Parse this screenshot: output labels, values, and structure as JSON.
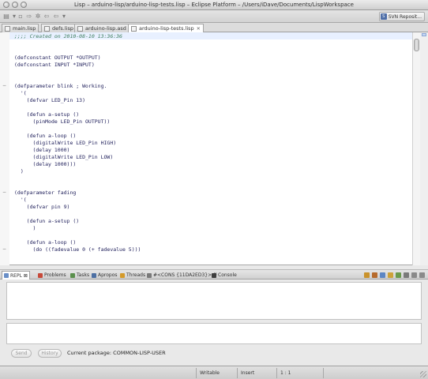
{
  "window": {
    "title": "Lisp – arduino-lisp/arduino-lisp-tests.lisp – Eclipse Platform – /Users/iDave/Documents/LispWorkspace"
  },
  "toolbar": {
    "svn_label": "SVN Reposit...",
    "icons": [
      "new-file-icon",
      "dropdown-icon",
      "save-icon",
      "forward-icon",
      "settings-icon",
      "open-icon",
      "back-icon"
    ]
  },
  "editor_tabs": [
    {
      "label": "main.lisp",
      "active": false
    },
    {
      "label": "defs.lisp",
      "active": false
    },
    {
      "label": "arduino-lisp.asd",
      "active": false
    },
    {
      "label": "arduino-lisp-tests.lisp",
      "active": true
    }
  ],
  "editor": {
    "lines": [
      {
        "text": ";;;; Created on 2010-08-10 13:36:36",
        "kind": "comment"
      },
      {
        "text": "",
        "kind": "code"
      },
      {
        "text": "",
        "kind": "code"
      },
      {
        "text": "(defconstant OUTPUT *OUTPUT)",
        "kind": "code"
      },
      {
        "text": "(defconstant INPUT *INPUT)",
        "kind": "code"
      },
      {
        "text": "",
        "kind": "code"
      },
      {
        "text": "",
        "kind": "code"
      },
      {
        "text": "(defparameter blink ; Working.",
        "kind": "code"
      },
      {
        "text": "  '(",
        "kind": "code"
      },
      {
        "text": "    (defvar LED_Pin 13)",
        "kind": "code"
      },
      {
        "text": "",
        "kind": "code"
      },
      {
        "text": "    (defun a-setup ()",
        "kind": "code"
      },
      {
        "text": "      (pinMode LED_Pin OUTPUT))",
        "kind": "code"
      },
      {
        "text": "",
        "kind": "code"
      },
      {
        "text": "    (defun a-loop ()",
        "kind": "code"
      },
      {
        "text": "      (digitalWrite LED_Pin HIGH)",
        "kind": "code"
      },
      {
        "text": "      (delay 1000)",
        "kind": "code"
      },
      {
        "text": "      (digitalWrite LED_Pin LOW)",
        "kind": "code"
      },
      {
        "text": "      (delay 1000)))",
        "kind": "code"
      },
      {
        "text": "  )",
        "kind": "code"
      },
      {
        "text": "",
        "kind": "code"
      },
      {
        "text": "",
        "kind": "code"
      },
      {
        "text": "(defparameter fading",
        "kind": "code"
      },
      {
        "text": "  '(",
        "kind": "code"
      },
      {
        "text": "    (defvar pin 9)",
        "kind": "code"
      },
      {
        "text": "",
        "kind": "code"
      },
      {
        "text": "    (defun a-setup ()",
        "kind": "code"
      },
      {
        "text": "      )",
        "kind": "code"
      },
      {
        "text": "",
        "kind": "code"
      },
      {
        "text": "    (defun a-loop ()",
        "kind": "code"
      },
      {
        "text": "      (do ((fadevalue 0 (+ fadevalue 5)))",
        "kind": "code"
      }
    ],
    "fold_markers": [
      "−",
      "−",
      "−"
    ]
  },
  "view_tabs": [
    {
      "label": "REPL",
      "active": true,
      "close": "⊠",
      "color": "#6a8fc7"
    },
    {
      "label": "Problems",
      "active": false,
      "close": "",
      "color": "#c74a3a"
    },
    {
      "label": "Tasks",
      "active": false,
      "close": "",
      "color": "#5a8f4c"
    },
    {
      "label": "Apropos",
      "active": false,
      "close": "",
      "color": "#4c6fa3"
    },
    {
      "label": "Threads",
      "active": false,
      "close": "",
      "color": "#d49a2a"
    },
    {
      "label": "#<CONS {11DA2ED3}> ()",
      "active": false,
      "close": "",
      "color": "#7a7a7a"
    },
    {
      "label": "Console",
      "active": false,
      "close": "",
      "color": "#3e3e3e"
    }
  ],
  "view_tools": [
    {
      "name": "clear-icon",
      "color": "#c9922c"
    },
    {
      "name": "pin-icon",
      "color": "#b66a2c"
    },
    {
      "name": "link-icon",
      "color": "#5c86c4"
    },
    {
      "name": "lock-icon",
      "color": "#cda23a"
    },
    {
      "name": "open-console-icon",
      "color": "#6a9a4c"
    },
    {
      "name": "menu-icon",
      "color": "#7a7a7a"
    },
    {
      "name": "minimize-icon",
      "color": "#8a8a8a"
    },
    {
      "name": "maximize-icon",
      "color": "#8a8a8a"
    }
  ],
  "repl": {
    "send_label": "Send",
    "history_label": "History",
    "current_package": "Current package: COMMON-LISP-USER"
  },
  "status": {
    "writable": "Writable",
    "insert": "Insert",
    "position": "1 : 1"
  }
}
